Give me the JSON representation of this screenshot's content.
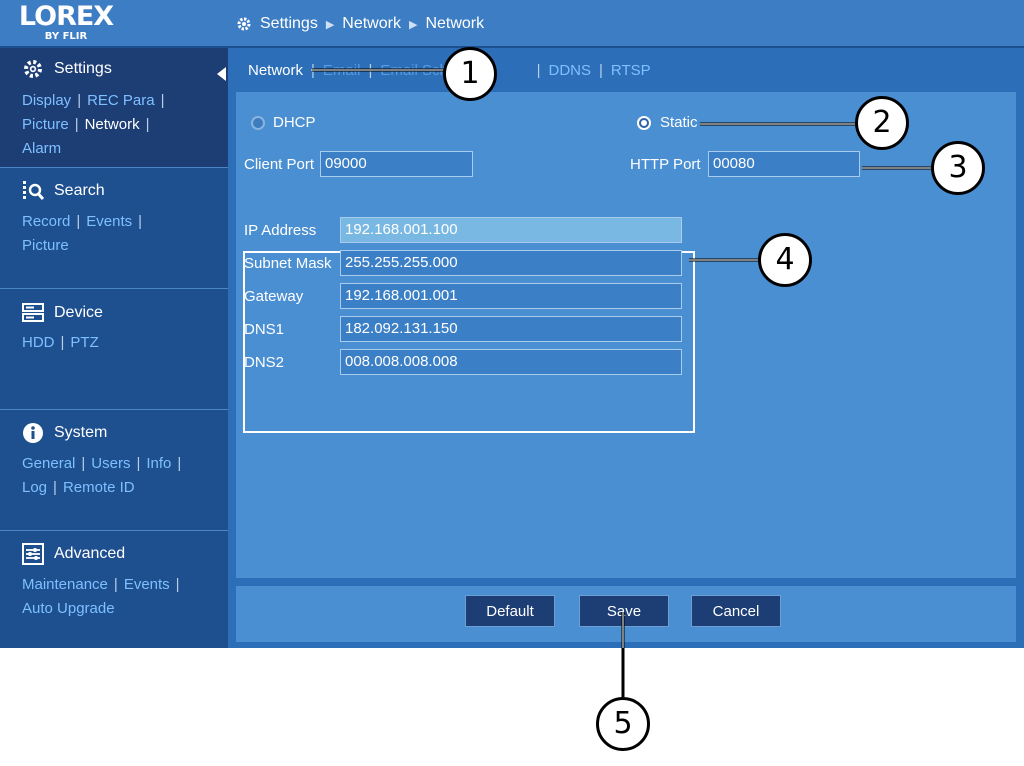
{
  "logo": {
    "brand": "LOREX",
    "sub": "BY FLIR"
  },
  "breadcrumb": [
    "Settings",
    "Network",
    "Network"
  ],
  "sidebar": {
    "sections": [
      {
        "title": "Settings",
        "icon": "gear-icon",
        "items": [
          "Display",
          "REC Para",
          "Picture",
          "Network",
          "Alarm"
        ],
        "current": "Network"
      },
      {
        "title": "Search",
        "icon": "search-list-icon",
        "items": [
          "Record",
          "Events",
          "Picture"
        ]
      },
      {
        "title": "Device",
        "icon": "device-icon",
        "items": [
          "HDD",
          "PTZ"
        ]
      },
      {
        "title": "System",
        "icon": "info-icon",
        "items": [
          "General",
          "Users",
          "Info",
          "Log",
          "Remote ID"
        ]
      },
      {
        "title": "Advanced",
        "icon": "sliders-icon",
        "items": [
          "Maintenance",
          "Events",
          "Auto Upgrade"
        ]
      }
    ]
  },
  "tabs": [
    "Network",
    "Email",
    "Email Schedule",
    "DDNS",
    "RTSP"
  ],
  "tabs_visible": {
    "network": "Network",
    "ddns": "DDNS",
    "rtsp": "RTSP"
  },
  "form": {
    "dhcp_label": "DHCP",
    "static_label": "Static",
    "mode_selected": "Static",
    "client_port_label": "Client Port",
    "client_port": "09000",
    "http_port_label": "HTTP Port",
    "http_port": "00080",
    "ip_address_label": "IP Address",
    "ip_address": "192.168.001.100",
    "subnet_mask_label": "Subnet Mask",
    "subnet_mask": "255.255.255.000",
    "gateway_label": "Gateway",
    "gateway": "192.168.001.001",
    "dns1_label": "DNS1",
    "dns1": "182.092.131.150",
    "dns2_label": "DNS2",
    "dns2": "008.008.008.008"
  },
  "buttons": {
    "default": "Default",
    "save": "Save",
    "cancel": "Cancel"
  },
  "callouts": [
    "1",
    "2",
    "3",
    "4",
    "5"
  ]
}
